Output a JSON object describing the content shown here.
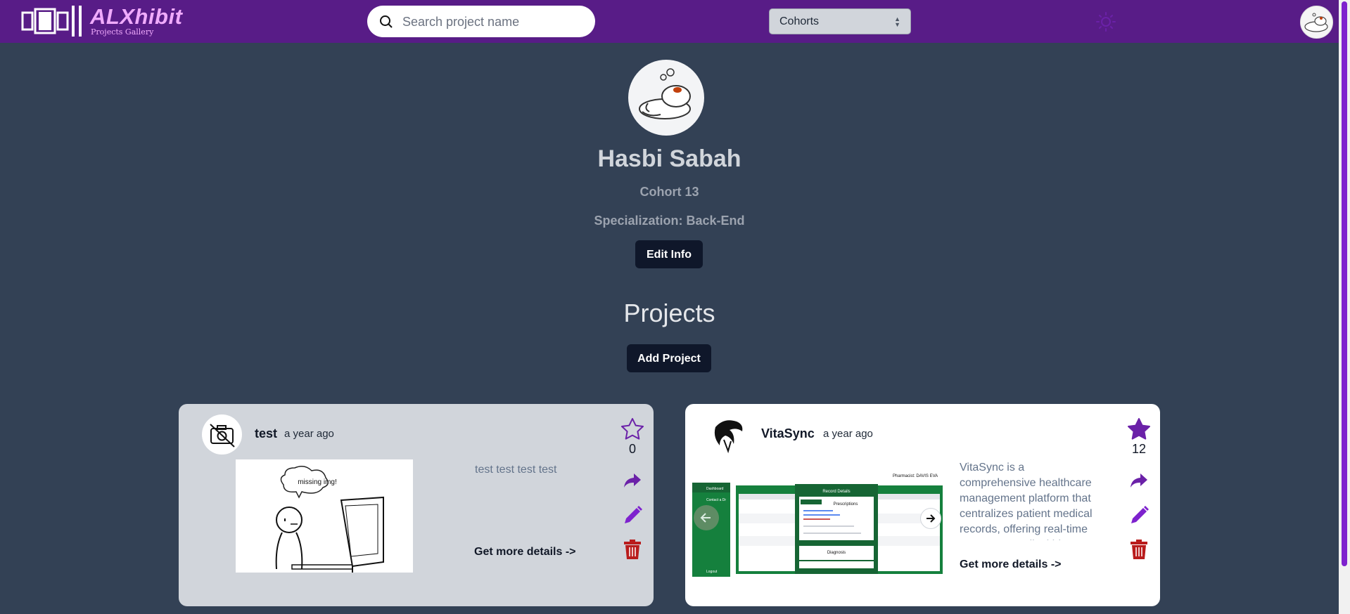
{
  "nav": {
    "logo_title": "ALXhibit",
    "logo_subtitle": "Projects Gallery",
    "search_placeholder": "Search project name",
    "cohort_select": "Cohorts"
  },
  "profile": {
    "name": "Hasbi Sabah",
    "cohort": "Cohort 13",
    "specialization": "Specialization: Back-End",
    "edit_label": "Edit Info"
  },
  "projects": {
    "heading": "Projects",
    "add_label": "Add Project",
    "cards": [
      {
        "title": "test",
        "time": "a year ago",
        "stars": "0",
        "description": "test test test test",
        "more": "Get more details ->",
        "image_caption": "missing img!"
      },
      {
        "title": "VitaSync",
        "time": "a year ago",
        "stars": "12",
        "description": "VitaSync is a comprehensive healthcare management platform that centralizes patient medical records, offering real-time access to medical history tracking and",
        "more": "Get more details ->",
        "screenshot": {
          "pharmacist": "Pharmacist: DAVIS EVA",
          "dashboard": "Dashboard",
          "contact": "Contact a Dr",
          "record_details": "Record Details",
          "prescriptions": "Prescriptions",
          "diagnosis": "Diagnosis",
          "logout": "Logout"
        }
      }
    ]
  },
  "colors": {
    "navbar": "#581c87",
    "background": "#334155",
    "accent": "#7e22ce",
    "delete": "#b91c1c"
  },
  "icons": [
    "logo-icon",
    "search-icon",
    "sun-icon",
    "star-icon",
    "share-icon",
    "edit-icon",
    "delete-icon",
    "no-camera-icon",
    "arrow-left-icon",
    "arrow-right-icon"
  ]
}
